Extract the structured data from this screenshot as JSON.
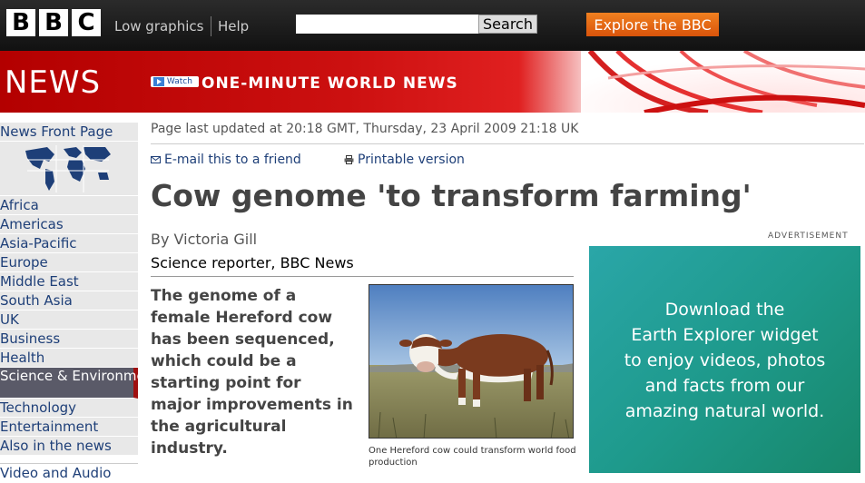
{
  "header": {
    "logo_letters": [
      "B",
      "B",
      "C"
    ],
    "low_graphics": "Low graphics",
    "help": "Help",
    "search_value": "",
    "search_button": "Search",
    "explore_button": "Explore the BBC"
  },
  "banner": {
    "section_title": "NEWS",
    "watch_label": "Watch",
    "one_minute": "ONE-MINUTE WORLD NEWS"
  },
  "sidebar": {
    "items": [
      {
        "label": "News Front Page"
      },
      {
        "label": "Africa"
      },
      {
        "label": "Americas"
      },
      {
        "label": "Asia-Pacific"
      },
      {
        "label": "Europe"
      },
      {
        "label": "Middle East"
      },
      {
        "label": "South Asia"
      },
      {
        "label": "UK"
      },
      {
        "label": "Business"
      },
      {
        "label": "Health"
      },
      {
        "label": "Science & Environment",
        "selected": true
      },
      {
        "label": "Technology"
      },
      {
        "label": "Entertainment"
      },
      {
        "label": "Also in the news"
      },
      {
        "label": "Video and Audio"
      }
    ]
  },
  "article": {
    "updated": "Page last updated at 20:18 GMT, Thursday, 23 April 2009 21:18 UK",
    "email_link": "E-mail this to a friend",
    "print_link": "Printable version",
    "headline": "Cow genome 'to transform farming'",
    "byline": "By Victoria Gill",
    "role": "Science reporter, BBC News",
    "intro": "The genome of a female Hereford cow has been sequenced, which could be a starting point for major improvements in the agricultural industry.",
    "photo_caption": "One Hereford cow could transform world food production"
  },
  "ad": {
    "label": "ADVERTISEMENT",
    "lines": [
      "Download the",
      "Earth Explorer widget",
      "to enjoy videos, photos",
      "and facts from our",
      "amazing natural world."
    ]
  },
  "colors": {
    "brand_red": "#b30000",
    "link_blue": "#1e3f78",
    "explore_orange": "#e0641a",
    "ad_teal": "#1e9a8c"
  }
}
